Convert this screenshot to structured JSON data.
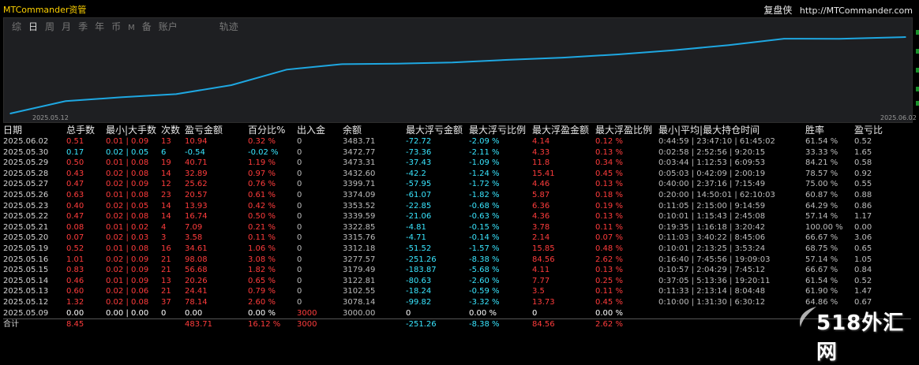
{
  "app_title": "MTCommander资管",
  "brand": {
    "name": "复盘侠",
    "url": "http://MTCommander.com"
  },
  "tabs": [
    {
      "label": "综",
      "active": false
    },
    {
      "label": "日",
      "active": true
    },
    {
      "label": "周",
      "active": false
    },
    {
      "label": "月",
      "active": false
    },
    {
      "label": "季",
      "active": false
    },
    {
      "label": "年",
      "active": false
    },
    {
      "label": "币",
      "active": false
    },
    {
      "label": "M",
      "active": false
    },
    {
      "label": "备",
      "active": false
    },
    {
      "label": "账户",
      "active": false
    },
    {
      "label": "轨迹",
      "active": false
    }
  ],
  "chart_data": {
    "type": "line",
    "xlabel_start": "2025.05.12",
    "xlabel_end": "2025.06.02",
    "color": "#1ea7e1",
    "x": [
      "2025.05.09",
      "2025.05.12",
      "2025.05.13",
      "2025.05.14",
      "2025.05.15",
      "2025.05.16",
      "2025.05.19",
      "2025.05.20",
      "2025.05.21",
      "2025.05.22",
      "2025.05.23",
      "2025.05.26",
      "2025.05.27",
      "2025.05.28",
      "2025.05.29",
      "2025.05.30",
      "2025.06.02"
    ],
    "values": [
      3000.0,
      3078.14,
      3102.55,
      3122.81,
      3179.49,
      3277.57,
      3312.18,
      3315.76,
      3322.85,
      3339.59,
      3353.52,
      3374.09,
      3399.71,
      3432.6,
      3473.31,
      3472.77,
      3483.71
    ],
    "ylim": [
      3000,
      3483.71
    ]
  },
  "table": {
    "headers": [
      "日期",
      "总手数",
      "最小|大手数",
      "次数",
      "盈亏金额",
      "百分比%",
      "出入金",
      "余额",
      "最大浮亏金额",
      "最大浮亏比例",
      "最大浮盈金额",
      "最大浮盈比例",
      "最小|平均|最大持仓时间",
      "胜率",
      "盈亏比"
    ],
    "rows": [
      [
        "2025.06.02",
        "0.51",
        "0.01 | 0.09",
        "13",
        "10.94",
        "0.32 %",
        "0",
        "3483.71",
        "-72.72",
        "-2.09 %",
        "4.14",
        "0.12 %",
        "0:44:59 | 23:47:10 | 61:45:02",
        "61.54 %",
        "0.52"
      ],
      [
        "2025.05.30",
        "0.17",
        "0.02 | 0.05",
        "6",
        "-0.54",
        "-0.02 %",
        "0",
        "3472.77",
        "-73.36",
        "-2.11 %",
        "4.33",
        "0.13 %",
        "0:02:58 | 2:52:56 | 9:20:15",
        "33.33 %",
        "1.65"
      ],
      [
        "2025.05.29",
        "0.50",
        "0.01 | 0.08",
        "19",
        "40.71",
        "1.19 %",
        "0",
        "3473.31",
        "-37.43",
        "-1.09 %",
        "11.8",
        "0.34 %",
        "0:03:44 | 1:12:53 | 6:09:53",
        "84.21 %",
        "0.58"
      ],
      [
        "2025.05.28",
        "0.43",
        "0.02 | 0.08",
        "14",
        "32.89",
        "0.97 %",
        "0",
        "3432.60",
        "-42.2",
        "-1.24 %",
        "15.41",
        "0.45 %",
        "0:05:03 | 0:42:09 | 2:00:19",
        "78.57 %",
        "0.92"
      ],
      [
        "2025.05.27",
        "0.47",
        "0.02 | 0.09",
        "12",
        "25.62",
        "0.76 %",
        "0",
        "3399.71",
        "-57.95",
        "-1.72 %",
        "4.46",
        "0.13 %",
        "0:40:00 | 2:37:16 | 7:15:49",
        "75.00 %",
        "0.55"
      ],
      [
        "2025.05.26",
        "0.63",
        "0.01 | 0.08",
        "23",
        "20.57",
        "0.61 %",
        "0",
        "3374.09",
        "-61.07",
        "-1.82 %",
        "5.87",
        "0.18 %",
        "0:20:00 | 14:50:01 | 62:10:03",
        "60.87 %",
        "0.88"
      ],
      [
        "2025.05.23",
        "0.40",
        "0.02 | 0.05",
        "14",
        "13.93",
        "0.42 %",
        "0",
        "3353.52",
        "-22.85",
        "-0.68 %",
        "6.36",
        "0.19 %",
        "0:11:05 | 2:15:00 | 9:14:59",
        "64.29 %",
        "0.86"
      ],
      [
        "2025.05.22",
        "0.47",
        "0.02 | 0.08",
        "14",
        "16.74",
        "0.50 %",
        "0",
        "3339.59",
        "-21.06",
        "-0.63 %",
        "4.36",
        "0.13 %",
        "0:10:01 | 1:15:43 | 2:45:08",
        "57.14 %",
        "1.17"
      ],
      [
        "2025.05.21",
        "0.08",
        "0.01 | 0.02",
        "4",
        "7.09",
        "0.21 %",
        "0",
        "3322.85",
        "-4.81",
        "-0.15 %",
        "3.78",
        "0.11 %",
        "0:19:35 | 1:16:18 | 3:20:42",
        "100.00 %",
        "0.00"
      ],
      [
        "2025.05.20",
        "0.07",
        "0.02 | 0.03",
        "3",
        "3.58",
        "0.11 %",
        "0",
        "3315.76",
        "-4.71",
        "-0.14 %",
        "2.14",
        "0.07 %",
        "0:11:03 | 3:40:22 | 8:45:06",
        "66.67 %",
        "3.06"
      ],
      [
        "2025.05.19",
        "0.52",
        "0.01 | 0.08",
        "16",
        "34.61",
        "1.06 %",
        "0",
        "3312.18",
        "-51.52",
        "-1.57 %",
        "15.85",
        "0.48 %",
        "0:10:01 | 2:13:25 | 3:53:24",
        "68.75 %",
        "0.65"
      ],
      [
        "2025.05.16",
        "1.01",
        "0.02 | 0.09",
        "21",
        "98.08",
        "3.08 %",
        "0",
        "3277.57",
        "-251.26",
        "-8.38 %",
        "84.56",
        "2.62 %",
        "0:16:40 | 7:45:56 | 19:09:03",
        "57.14 %",
        "1.05"
      ],
      [
        "2025.05.15",
        "0.83",
        "0.02 | 0.09",
        "21",
        "56.68",
        "1.82 %",
        "0",
        "3179.49",
        "-183.87",
        "-5.68 %",
        "4.11",
        "0.13 %",
        "0:10:57 | 2:04:29 | 7:45:12",
        "66.67 %",
        "0.84"
      ],
      [
        "2025.05.14",
        "0.46",
        "0.01 | 0.09",
        "13",
        "20.26",
        "0.65 %",
        "0",
        "3122.81",
        "-80.63",
        "-2.60 %",
        "7.77",
        "0.25 %",
        "0:37:05 | 5:13:36 | 19:20:11",
        "61.54 %",
        "0.52"
      ],
      [
        "2025.05.13",
        "0.60",
        "0.02 | 0.06",
        "21",
        "24.41",
        "0.79 %",
        "0",
        "3102.55",
        "-18.24",
        "-0.59 %",
        "3.5",
        "0.11 %",
        "0:11:33 | 2:13:14 | 8:04:48",
        "61.90 %",
        "1.47"
      ],
      [
        "2025.05.12",
        "1.32",
        "0.02 | 0.08",
        "37",
        "78.14",
        "2.60 %",
        "0",
        "3078.14",
        "-99.82",
        "-3.32 %",
        "13.73",
        "0.45 %",
        "0:10:00 | 1:31:30 | 6:30:12",
        "64.86 %",
        "0.67"
      ],
      [
        "2025.05.09",
        "0.00",
        "0.00 | 0.00",
        "0",
        "0.00",
        "0.00 %",
        "3000",
        "3000.00",
        "0",
        "0.00 %",
        "0",
        "0.00 %",
        "",
        "",
        ""
      ]
    ],
    "total": [
      "合计",
      "8.45",
      "",
      "",
      "483.71",
      "16.12 %",
      "3000",
      "",
      "-251.26",
      "-8.38 %",
      "84.56",
      "2.62 %",
      "",
      "",
      ""
    ]
  },
  "watermark": "518外汇网"
}
